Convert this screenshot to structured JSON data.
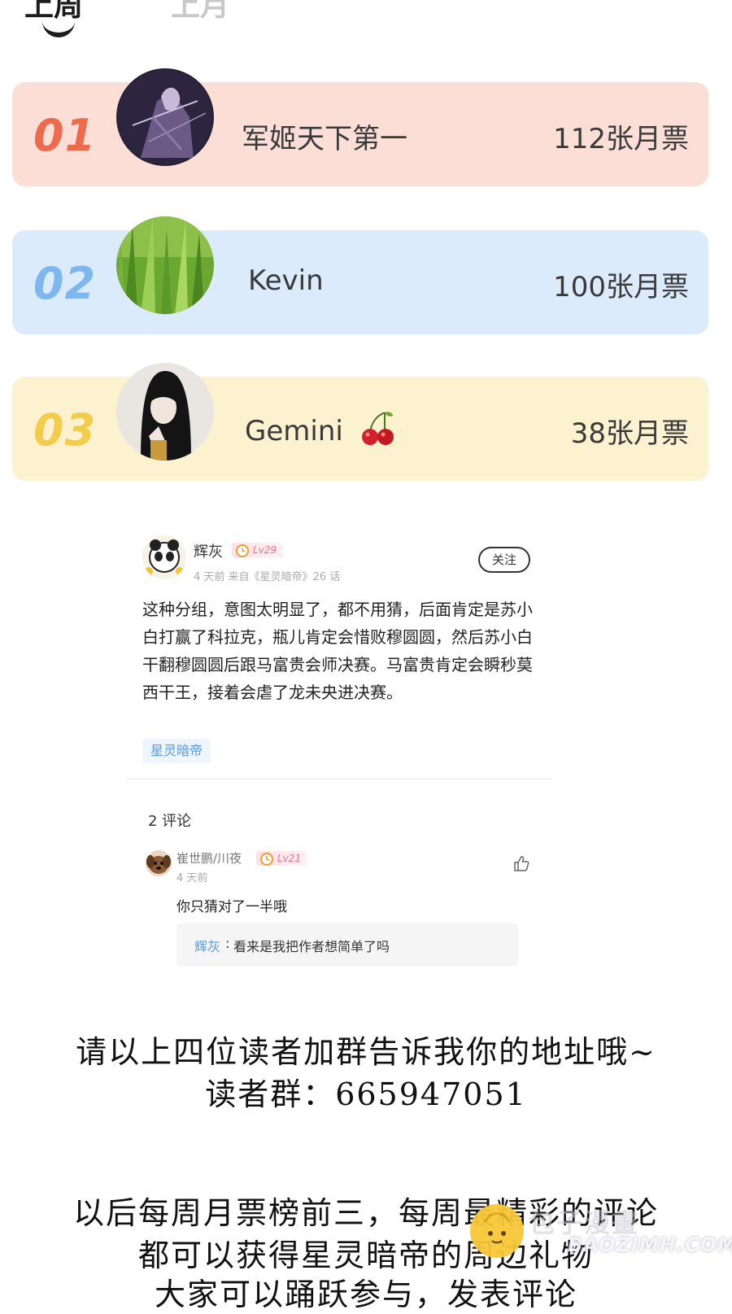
{
  "tabs": {
    "active": "上周",
    "inactive": "上月"
  },
  "ranking": [
    {
      "rank": "01",
      "name": "军姬天下第一",
      "votes": "112张月票"
    },
    {
      "rank": "02",
      "name": "Kevin",
      "votes": "100张月票"
    },
    {
      "rank": "03",
      "name": "Gemini",
      "votes": "38张月票"
    }
  ],
  "post": {
    "user": "辉灰",
    "level": "Lv29",
    "meta": "4 天前  来自《星灵暗帝》26 话",
    "follow_label": "关注",
    "body": "这种分组，意图太明显了，都不用猜，后面肯定是苏小白打赢了科拉克，瓶儿肯定会惜败穆圆圆，然后苏小白干翻穆圆圆后跟马富贵会师决赛。马富贵肯定会瞬秒莫西干王，接着会虐了龙未央进决赛。",
    "tag": "星灵暗帝",
    "comment_count": "2 评论",
    "reply": {
      "user": "崔世鹏/川夜",
      "level": "Lv21",
      "time": "4 天前",
      "text": "你只猜对了一半哦",
      "quote_user": "辉灰",
      "quote_text": "看来是我把作者想简单了吗"
    }
  },
  "notes": {
    "line1": "请以上四位读者加群告诉我你的地址哦~",
    "line2": "读者群：665947051",
    "line3": "以后每周月票榜前三，每周最精彩的评论",
    "line4": "都可以获得星灵暗帝的周边礼物",
    "line5": "大家可以踊跃参与，发表评论"
  },
  "watermark": {
    "text1": "包子漫畫",
    "text2": "BAOZIMH.COM"
  },
  "colors": {
    "rank1_bg": "#fbdfd7",
    "rank2_bg": "#dcebfb",
    "rank3_bg": "#fcf2cf",
    "rank1_num": "#ee6a4c",
    "rank2_num": "#7db7ef",
    "rank3_num": "#f3cc4a",
    "link_blue": "#5c9ae0"
  }
}
